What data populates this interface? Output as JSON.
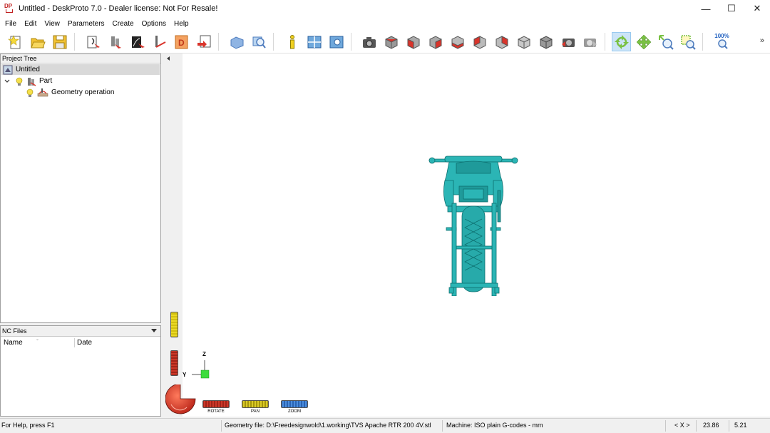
{
  "window": {
    "title": "Untitled - DeskProto 7.0 - Dealer license: Not For Resale!",
    "logo_text": "DP",
    "minimize": "—",
    "maximize": "☐",
    "close": "✕"
  },
  "menu": [
    "File",
    "Edit",
    "View",
    "Parameters",
    "Create",
    "Options",
    "Help"
  ],
  "toolbar": {
    "zoom_percent": "100%",
    "more": "»",
    "accent_green": "#7ac143",
    "accent_red": "#d9342b"
  },
  "project_tree": {
    "header": "Project Tree",
    "root": "Untitled",
    "part": "Part",
    "operation": "Geometry operation"
  },
  "nc_files": {
    "header": "NC Files",
    "col_name": "Name",
    "col_date": "Date"
  },
  "viewport": {
    "model_color": "#2bb5b5",
    "axis_z": "Z",
    "axis_y": "Y",
    "wheel_rotate": "ROTATE",
    "wheel_pan": "PAN",
    "wheel_zoom": "ZOOM"
  },
  "status": {
    "help": "For Help, press F1",
    "geometry_file": "Geometry file: D:\\Freedesignwold\\1.working\\TVS Apache RTR 200 4V.stl",
    "machine": "Machine: ISO plain G-codes - mm",
    "nav": "< X >",
    "coord_1": "23.86",
    "coord_2": "5.21"
  }
}
